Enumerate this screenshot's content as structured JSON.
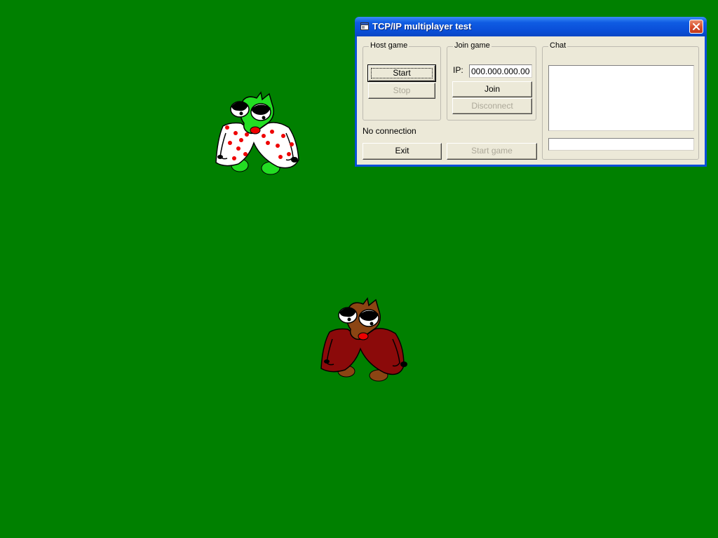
{
  "window": {
    "title": "TCP/IP multiplayer test"
  },
  "host_group": {
    "legend": "Host game",
    "start_label": "Start",
    "stop_label": "Stop"
  },
  "join_group": {
    "legend": "Join game",
    "ip_label": "IP:",
    "ip_value": "000.000.000.000",
    "join_label": "Join",
    "disconnect_label": "Disconnect"
  },
  "chat_group": {
    "legend": "Chat",
    "messages": "",
    "input_value": ""
  },
  "status": {
    "text": "No connection"
  },
  "footer": {
    "exit_label": "Exit",
    "start_game_label": "Start game"
  },
  "colors": {
    "background": "#008000",
    "player1_body": "#22dd22",
    "player1_coat": "#ffffff",
    "player1_dots": "#ee0000",
    "player2_body": "#8b4513",
    "player2_coat": "#8b0a0a"
  }
}
